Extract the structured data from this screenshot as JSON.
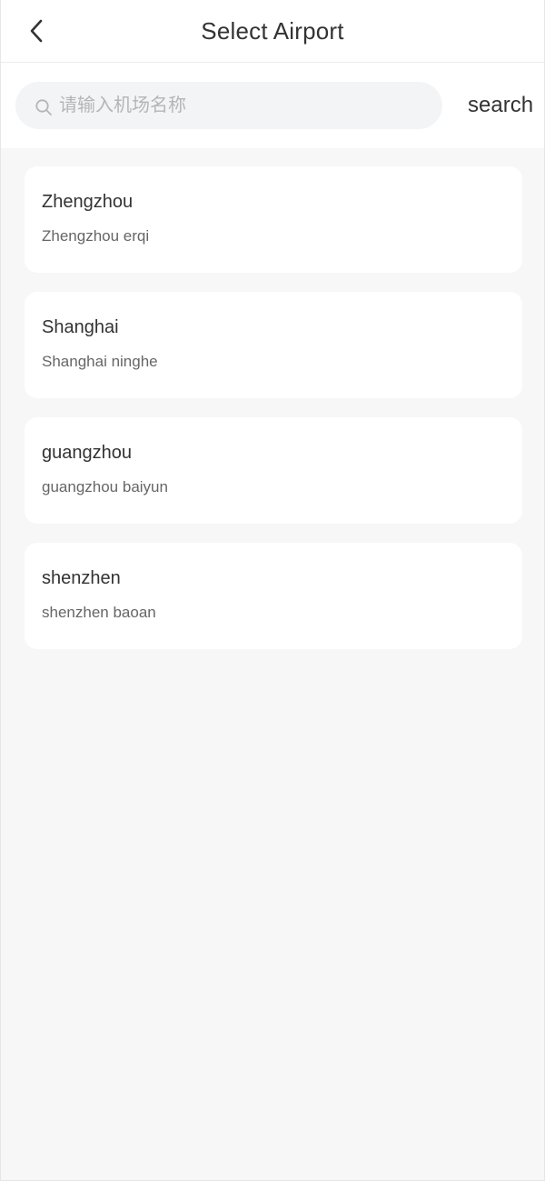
{
  "header": {
    "title": "Select Airport",
    "back_icon": "chevron-left-icon"
  },
  "search": {
    "placeholder": "请输入机场名称",
    "value": "",
    "button_label": "search",
    "icon": "search-icon"
  },
  "airports": [
    {
      "city": "Zhengzhou",
      "airport": "Zhengzhou erqi"
    },
    {
      "city": "Shanghai",
      "airport": "Shanghai ninghe"
    },
    {
      "city": "guangzhou",
      "airport": "guangzhou baiyun"
    },
    {
      "city": "shenzhen",
      "airport": "shenzhen baoan"
    }
  ],
  "colors": {
    "background": "#f7f7f7",
    "card": "#ffffff",
    "search_box": "#f3f4f6",
    "text_primary": "#333333",
    "text_secondary": "#666666",
    "placeholder": "#b5b5b5"
  }
}
